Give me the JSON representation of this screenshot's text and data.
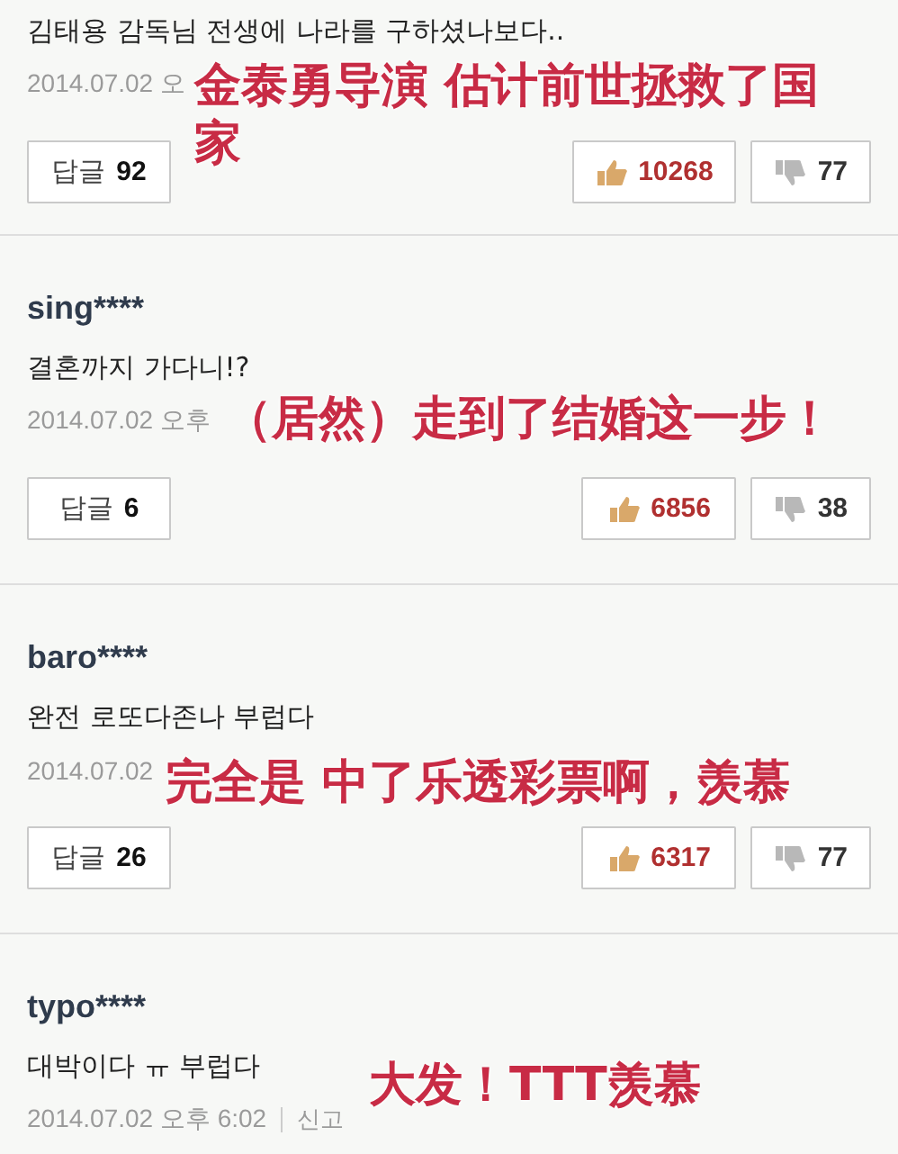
{
  "comments": [
    {
      "text": "김태용 감독님 전생에 나라를 구하셨나보다..",
      "date": "2014.07.02 오",
      "reply_label": "답글",
      "reply_count": "92",
      "likes": "10268",
      "dislikes": "77",
      "caption": [
        "金泰勇导演 估计前世拯救了国",
        "家"
      ]
    },
    {
      "username": "sing****",
      "text": "결혼까지 가다니!?",
      "date": "2014.07.02 오후",
      "reply_label": "답글",
      "reply_count": "6",
      "likes": "6856",
      "dislikes": "38",
      "caption": [
        "（居然）走到了结婚这一步！"
      ]
    },
    {
      "username": "baro****",
      "text": "완전 로또다존나 부럽다",
      "date": "2014.07.02",
      "reply_label": "답글",
      "reply_count": "26",
      "likes": "6317",
      "dislikes": "77",
      "caption": [
        "完全是 中了乐透彩票啊，羡慕"
      ]
    },
    {
      "username": "typo****",
      "text": "대박이다 ㅠ 부럽다",
      "date": "2014.07.02 오후 6:02",
      "report": "신고",
      "caption": [
        "大发！TTT羡慕"
      ]
    }
  ]
}
